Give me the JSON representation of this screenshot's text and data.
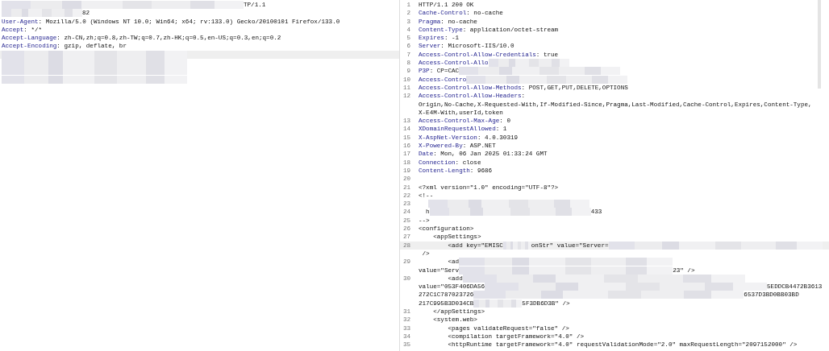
{
  "request": {
    "lines": [
      {
        "current": false,
        "parts": [
          {
            "kind": "blur_xxxl"
          },
          {
            "kind": "text",
            "text": "TP/1.1"
          }
        ]
      },
      {
        "current": false,
        "parts": [
          {
            "kind": "blur_m"
          },
          {
            "kind": "text",
            "text": "82"
          }
        ]
      },
      {
        "current": false,
        "parts": [
          {
            "kind": "name",
            "text": "User-Agent"
          },
          {
            "kind": "text",
            "text": ": Mozilla/5.0 (Windows NT 10.0; Win64; x64; rv:133.0) Gecko/20100101 Firefox/133.0"
          }
        ]
      },
      {
        "current": false,
        "parts": [
          {
            "kind": "name",
            "text": "Accept"
          },
          {
            "kind": "text",
            "text": ": */*"
          }
        ]
      },
      {
        "current": false,
        "parts": [
          {
            "kind": "name",
            "text": "Accept-Language"
          },
          {
            "kind": "text",
            "text": ": zh-CN,zh;q=0.8,zh-TW;q=0.7,zh-HK;q=0.5,en-US;q=0.3,en;q=0.2"
          }
        ]
      },
      {
        "current": false,
        "parts": [
          {
            "kind": "name",
            "text": "Accept-Encoding"
          },
          {
            "kind": "text",
            "text": ": gzip, deflate, br"
          }
        ]
      },
      {
        "current": true,
        "parts": [
          {
            "kind": "blur_xl"
          }
        ]
      },
      {
        "current": false,
        "parts": [
          {
            "kind": "blur_xl"
          }
        ]
      },
      {
        "current": false,
        "parts": [
          {
            "kind": "blur_xl"
          }
        ]
      },
      {
        "current": false,
        "parts": [
          {
            "kind": "blur_xl"
          }
        ]
      }
    ]
  },
  "response": {
    "lines": [
      {
        "number": "1",
        "current": false,
        "parts": [
          {
            "kind": "text",
            "text": "HTTP/1.1 200 OK"
          }
        ]
      },
      {
        "number": "2",
        "current": false,
        "parts": [
          {
            "kind": "name",
            "text": "Cache-Control"
          },
          {
            "kind": "text",
            "text": ": no-cache"
          }
        ]
      },
      {
        "number": "3",
        "current": false,
        "parts": [
          {
            "kind": "name",
            "text": "Pragma"
          },
          {
            "kind": "text",
            "text": ": no-cache"
          }
        ]
      },
      {
        "number": "4",
        "current": false,
        "parts": [
          {
            "kind": "name",
            "text": "Content-Type"
          },
          {
            "kind": "text",
            "text": ": application/octet-stream"
          }
        ]
      },
      {
        "number": "5",
        "current": false,
        "parts": [
          {
            "kind": "name",
            "text": "Expires"
          },
          {
            "kind": "text",
            "text": ": -1"
          }
        ]
      },
      {
        "number": "6",
        "current": false,
        "parts": [
          {
            "kind": "name",
            "text": "Server"
          },
          {
            "kind": "text",
            "text": ": Microsoft-IIS/10.0"
          }
        ]
      },
      {
        "number": "7",
        "current": false,
        "parts": [
          {
            "kind": "name",
            "text": "Access-Control-Allow-Credentials"
          },
          {
            "kind": "text",
            "text": ": true"
          }
        ]
      },
      {
        "number": "8",
        "current": false,
        "parts": [
          {
            "kind": "name",
            "text": "Access-Control-Allo"
          },
          {
            "kind": "blur_m"
          }
        ]
      },
      {
        "number": "9",
        "current": false,
        "parts": [
          {
            "kind": "name",
            "text": "P3P"
          },
          {
            "kind": "text",
            "text": ": CP=CAC"
          },
          {
            "kind": "blur_l"
          }
        ]
      },
      {
        "number": "10",
        "current": false,
        "parts": [
          {
            "kind": "name",
            "text": "Access-Contro"
          },
          {
            "kind": "blur_l"
          }
        ]
      },
      {
        "number": "11",
        "current": false,
        "parts": [
          {
            "kind": "name",
            "text": "Access-Control-Allow-Methods"
          },
          {
            "kind": "text",
            "text": ": POST,GET,PUT,DELETE,OPTIONS"
          }
        ]
      },
      {
        "number": "12",
        "current": false,
        "parts": [
          {
            "kind": "name",
            "text": "Access-Control-Allow-Headers"
          },
          {
            "kind": "text",
            "text": ":"
          }
        ]
      },
      {
        "current": false,
        "parts": [
          {
            "kind": "text",
            "text": "Origin,No-Cache,X-Requested-With,If-Modified-Since,Pragma,Last-Modified,Cache-Control,Expires,Content-Type,"
          }
        ]
      },
      {
        "current": false,
        "parts": [
          {
            "kind": "text",
            "text": "X-E4M-With,userId,token"
          }
        ]
      },
      {
        "number": "13",
        "current": false,
        "parts": [
          {
            "kind": "name",
            "text": "Access-Control-Max-Age"
          },
          {
            "kind": "text",
            "text": ": 0"
          }
        ]
      },
      {
        "number": "14",
        "current": false,
        "parts": [
          {
            "kind": "name",
            "text": "XDomainRequestAllowed"
          },
          {
            "kind": "text",
            "text": ": 1"
          }
        ]
      },
      {
        "number": "15",
        "current": false,
        "parts": [
          {
            "kind": "name",
            "text": "X-AspNet-Version"
          },
          {
            "kind": "text",
            "text": ": 4.0.30319"
          }
        ]
      },
      {
        "number": "16",
        "current": false,
        "parts": [
          {
            "kind": "name",
            "text": "X-Powered-By"
          },
          {
            "kind": "text",
            "text": ": ASP.NET"
          }
        ]
      },
      {
        "number": "17",
        "current": false,
        "parts": [
          {
            "kind": "name",
            "text": "Date"
          },
          {
            "kind": "text",
            "text": ": Mon, 06 Jan 2025 01:33:24 GMT"
          }
        ]
      },
      {
        "number": "18",
        "current": false,
        "parts": [
          {
            "kind": "name",
            "text": "Connection"
          },
          {
            "kind": "text",
            "text": ": close"
          }
        ]
      },
      {
        "number": "19",
        "current": false,
        "parts": [
          {
            "kind": "name",
            "text": "Content-Length"
          },
          {
            "kind": "text",
            "text": ": 9686"
          }
        ]
      },
      {
        "number": "20",
        "current": false
      },
      {
        "number": "21",
        "current": false,
        "parts": [
          {
            "kind": "text",
            "text": "<?xml version=\"1.0\" encoding=\"UTF-8\"?>"
          }
        ]
      },
      {
        "number": "22",
        "current": false,
        "parts": [
          {
            "kind": "text",
            "text": "<!--"
          }
        ]
      },
      {
        "number": "23",
        "current": false,
        "parts": [
          {
            "kind": "blur_l_indented"
          }
        ]
      },
      {
        "number": "24",
        "current": false,
        "parts": [
          {
            "kind": "text",
            "text": "  h"
          },
          {
            "kind": "blur_l"
          },
          {
            "kind": "text",
            "text": "433"
          }
        ]
      },
      {
        "number": "25",
        "current": false,
        "parts": [
          {
            "kind": "text",
            "text": "-->"
          }
        ]
      },
      {
        "number": "26",
        "current": false,
        "parts": [
          {
            "kind": "text",
            "text": "<configuration>"
          }
        ]
      },
      {
        "number": "27",
        "current": false,
        "parts": [
          {
            "kind": "text",
            "text": "    <appSettings>"
          }
        ]
      },
      {
        "number": "28",
        "current": true,
        "parts": [
          {
            "kind": "text",
            "text": "        <add key=\"EMISC"
          },
          {
            "kind": "blur_xs"
          },
          {
            "kind": "text",
            "text": "onStr\" value=\"Server="
          },
          {
            "kind": "blur_xxl"
          }
        ]
      },
      {
        "current": false,
        "parts": [
          {
            "kind": "text",
            "text": " />"
          }
        ]
      },
      {
        "number": "29",
        "current": false,
        "parts": [
          {
            "kind": "text",
            "text": "        <ad"
          },
          {
            "kind": "blur_xxl"
          }
        ]
      },
      {
        "current": false,
        "parts": [
          {
            "kind": "text",
            "text": "value=\"Serv"
          },
          {
            "kind": "blur_xxl"
          },
          {
            "kind": "text",
            "text": "23\" />"
          }
        ]
      },
      {
        "number": "30",
        "current": false,
        "parts": [
          {
            "kind": "text",
            "text": "        <add"
          },
          {
            "kind": "blur_full"
          }
        ]
      },
      {
        "current": false,
        "parts": [
          {
            "kind": "text",
            "text": "value=\"053F406DA56"
          },
          {
            "kind": "blur_full"
          },
          {
            "kind": "text",
            "text": "5EDDCB4472B3613"
          }
        ]
      },
      {
        "current": false,
        "parts": [
          {
            "kind": "text",
            "text": "272C1C787023726"
          },
          {
            "kind": "blur_big"
          },
          {
            "kind": "text",
            "text": "6537D3BD0BB03BD"
          }
        ]
      },
      {
        "current": false,
        "parts": [
          {
            "kind": "text",
            "text": "217C995B3D034CB"
          },
          {
            "kind": "blur_s"
          },
          {
            "kind": "text",
            "text": "5F3DB6D3B\" />"
          }
        ]
      },
      {
        "number": "31",
        "current": false,
        "parts": [
          {
            "kind": "text",
            "text": "    </appSettings>"
          }
        ]
      },
      {
        "number": "32",
        "current": false,
        "parts": [
          {
            "kind": "text",
            "text": "    <system.web>"
          }
        ]
      },
      {
        "number": "33",
        "current": false,
        "parts": [
          {
            "kind": "text",
            "text": "        <pages validateRequest=\"false\" />"
          }
        ]
      },
      {
        "number": "34",
        "current": false,
        "parts": [
          {
            "kind": "text",
            "text": "        <compilation targetFramework=\"4.0\" />"
          }
        ]
      },
      {
        "number": "35",
        "current": false,
        "parts": [
          {
            "kind": "text",
            "text": "        <httpRuntime targetFramework=\"4.0\" requestValidationMode=\"2.0\" maxRequestLength=\"2097152000\" />"
          }
        ]
      }
    ]
  }
}
